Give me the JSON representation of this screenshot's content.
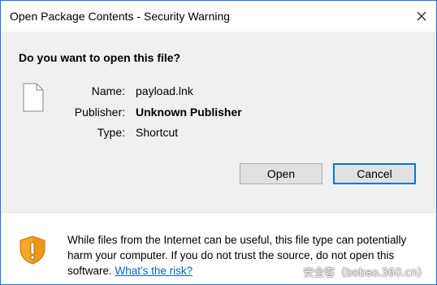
{
  "window": {
    "title": "Open Package Contents - Security Warning",
    "close_icon": "close-icon"
  },
  "prompt": {
    "heading": "Do you want to open this file?"
  },
  "file": {
    "icon": "document-icon",
    "name_label": "Name:",
    "name_value": "payload.lnk",
    "publisher_label": "Publisher:",
    "publisher_value": "Unknown Publisher",
    "type_label": "Type:",
    "type_value": "Shortcut"
  },
  "buttons": {
    "open_label": "Open",
    "cancel_label": "Cancel"
  },
  "warning": {
    "icon": "security-shield-icon",
    "text": "While files from the Internet can be useful, this file type can potentially harm your computer. If you do not trust the source, do not open this software.",
    "link_text": "What's the risk?"
  },
  "watermark": {
    "text": "安全客（bobao.360.cn）"
  },
  "colors": {
    "accent": "#0078d7",
    "link": "#0066cc",
    "window_border": "#1b73d5",
    "shield_orange": "#f5a623"
  }
}
